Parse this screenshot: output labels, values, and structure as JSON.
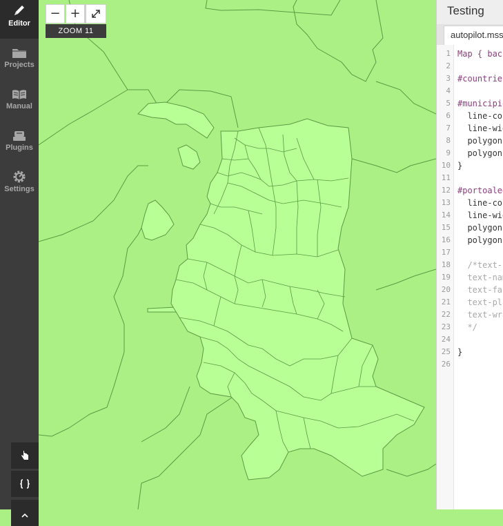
{
  "sidebar": {
    "items": [
      {
        "label": "Editor",
        "icon": "pencil-icon"
      },
      {
        "label": "Projects",
        "icon": "folder-icon"
      },
      {
        "label": "Manual",
        "icon": "book-icon"
      },
      {
        "label": "Plugins",
        "icon": "plugin-icon"
      },
      {
        "label": "Settings",
        "icon": "gear-icon"
      }
    ],
    "tools": [
      {
        "icon": "hand-pointer-icon"
      },
      {
        "icon": "braces-icon"
      }
    ]
  },
  "map": {
    "zoom_in": "+",
    "zoom_out": "−",
    "fullscreen_icon": "expand-icon",
    "zoom_label": "ZOOM 11",
    "colors": {
      "land": "#aaf084",
      "city": "#b8ff96",
      "stroke": "#5a9a44"
    }
  },
  "panel": {
    "title": "Testing",
    "tab": "autopilot.mss",
    "lines": [
      {
        "n": "1",
        "t": "Map { back",
        "c": "k-sel"
      },
      {
        "n": "2",
        "t": "",
        "c": "k-prop"
      },
      {
        "n": "3",
        "t": "#countries",
        "c": "k-sel"
      },
      {
        "n": "4",
        "t": "",
        "c": "k-prop"
      },
      {
        "n": "5",
        "t": "#municipio",
        "c": "k-sel"
      },
      {
        "n": "6",
        "t": "  line-col",
        "c": "k-prop"
      },
      {
        "n": "7",
        "t": "  line-wid",
        "c": "k-prop"
      },
      {
        "n": "8",
        "t": "  polygon-",
        "c": "k-prop"
      },
      {
        "n": "9",
        "t": "  polygon-",
        "c": "k-prop"
      },
      {
        "n": "10",
        "t": "}",
        "c": "k-prop"
      },
      {
        "n": "11",
        "t": "",
        "c": "k-prop"
      },
      {
        "n": "12",
        "t": "#portoaleg",
        "c": "k-sel"
      },
      {
        "n": "13",
        "t": "  line-col",
        "c": "k-prop"
      },
      {
        "n": "14",
        "t": "  line-wid",
        "c": "k-prop"
      },
      {
        "n": "15",
        "t": "  polygon-",
        "c": "k-prop"
      },
      {
        "n": "16",
        "t": "  polygon-",
        "c": "k-prop"
      },
      {
        "n": "17",
        "t": "",
        "c": "k-prop"
      },
      {
        "n": "18",
        "t": "  /*text-s",
        "c": "k-com"
      },
      {
        "n": "19",
        "t": "  text-nam",
        "c": "k-com"
      },
      {
        "n": "20",
        "t": "  text-fac",
        "c": "k-com"
      },
      {
        "n": "21",
        "t": "  text-pla",
        "c": "k-com"
      },
      {
        "n": "22",
        "t": "  text-wra",
        "c": "k-com"
      },
      {
        "n": "23",
        "t": "  */",
        "c": "k-com"
      },
      {
        "n": "24",
        "t": "",
        "c": "k-prop"
      },
      {
        "n": "25",
        "t": "}",
        "c": "k-prop"
      },
      {
        "n": "26",
        "t": "",
        "c": "k-prop"
      }
    ]
  }
}
